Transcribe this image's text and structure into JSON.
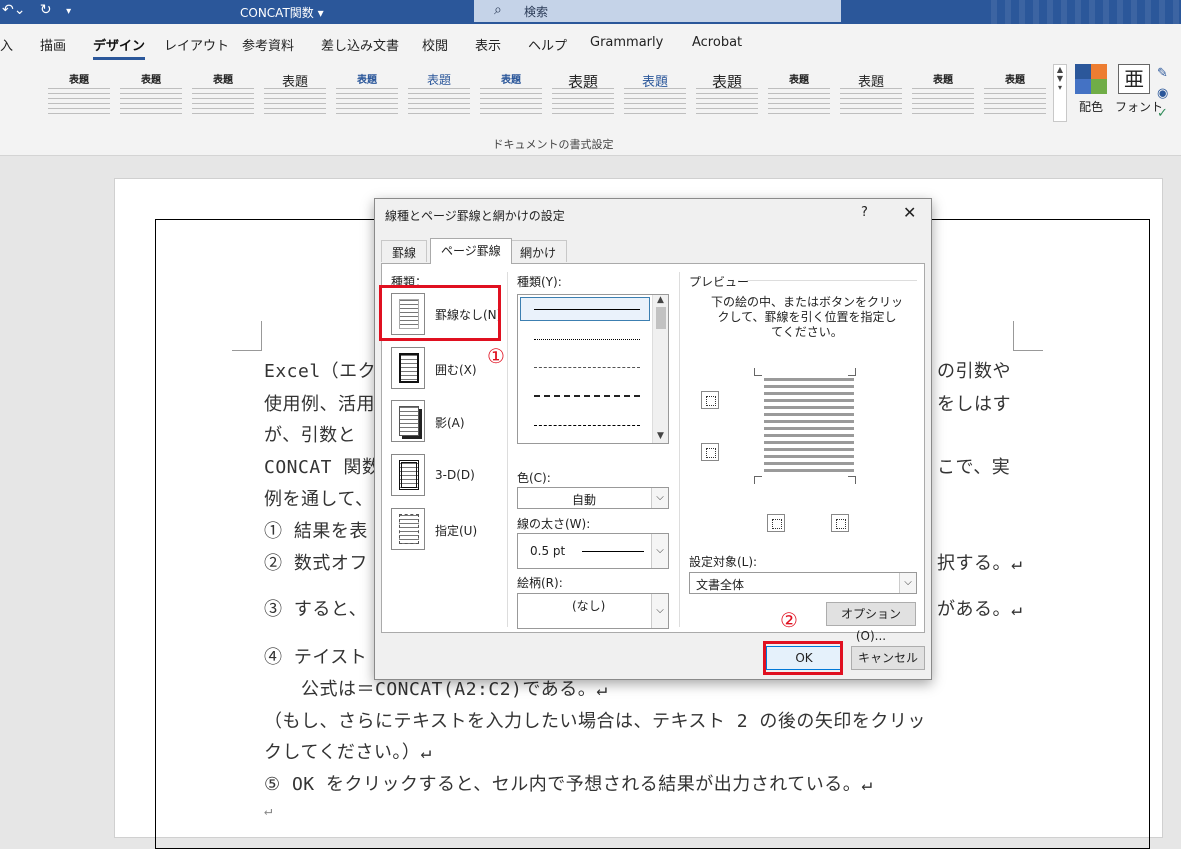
{
  "titlebar": {
    "undo_icon": "undo-icon",
    "redo_icon": "redo-icon",
    "customize_icon": "customize-qat-icon",
    "doc_title": "CONCAT関数 ▾",
    "search_placeholder": "検索"
  },
  "ribbon_tabs": [
    "入",
    "描画",
    "デザイン",
    "レイアウト",
    "参考資料",
    "差し込み文書",
    "校閲",
    "表示",
    "ヘルプ",
    "Grammarly",
    "Acrobat"
  ],
  "active_tab": "デザイン",
  "ribbon": {
    "style_titles": [
      "表題",
      "表題",
      "表題",
      "表題",
      "表題",
      "表題",
      "表題",
      "表題",
      "表題",
      "表題",
      "表題",
      "表題",
      "表題",
      "表題"
    ],
    "colors_label": "配色",
    "fonts_label": "フォント",
    "font_glyph": "亜",
    "group_label": "ドキュメントの書式設定",
    "theme_colors": [
      "#2b579a",
      "#ed7d31",
      "#70ad47",
      "#4472c4"
    ]
  },
  "document": {
    "lines": [
      "Excel（エク",
      "使用例、活用",
      "が、引数と",
      "CONCAT 関数",
      "例を通して、",
      "① 結果を表",
      "② 数式オフ",
      "③ すると、",
      "④ テイスト",
      "　　公式は＝CONCAT(A2:C2)である。↵",
      "（もし、さらにテキストを入力したい場合は、テキスト 2 の後の矢印をクリッ",
      "クしてください。）↵",
      "⑤ OK をクリックすると、セル内で予想される結果が出力されている。↵",
      "↵"
    ],
    "right_fragments": [
      "の引数や",
      "をしはす",
      "こで、実",
      "択する。↵",
      "がある。↵"
    ]
  },
  "dialog": {
    "title": "線種とページ罫線と網かけの設定",
    "help": "?",
    "close": "✕",
    "tabs": [
      "罫線",
      "ページ罫線",
      "網かけ"
    ],
    "active_tab": "ページ罫線",
    "setting_heading": "種類：",
    "settings": [
      "罫線なし(N)",
      "囲む(X)",
      "影(A)",
      "3-D(D)",
      "指定(U)"
    ],
    "style_label": "種類(Y):",
    "color_label": "色(C):",
    "color_value": "自動",
    "width_label": "線の太さ(W):",
    "width_value": "0.5 pt",
    "art_label": "絵柄(R):",
    "art_value": "(なし)",
    "preview_label": "プレビュー",
    "preview_instructions": [
      "下の絵の中、またはボタンをクリッ",
      "クして、罫線を引く位置を指定し",
      "てください。"
    ],
    "apply_label": "設定対象(L):",
    "apply_value": "文書全体",
    "options_button": "オプション(O)...",
    "ok_button": "OK",
    "cancel_button": "キャンセル"
  },
  "annotations": {
    "mark1": "①",
    "mark2": "②",
    "color": "#e01020"
  }
}
